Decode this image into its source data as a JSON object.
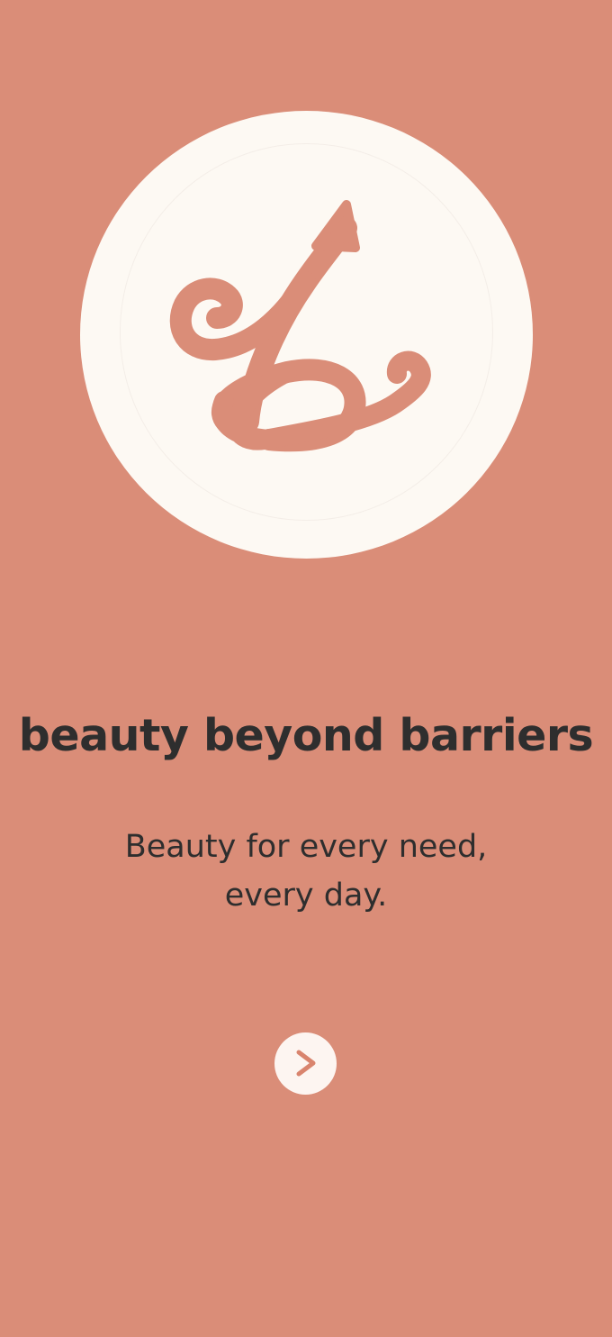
{
  "brand": {
    "logo_icon": "script-monogram-logo-icon",
    "accent_color": "#DA8D78",
    "badge_color": "#FDF9F3"
  },
  "onboarding": {
    "tagline": "beauty beyond barriers",
    "subtitle_line1": "Beauty for every need,",
    "subtitle_line2": "every day.",
    "next_icon": "chevron-right-icon"
  }
}
